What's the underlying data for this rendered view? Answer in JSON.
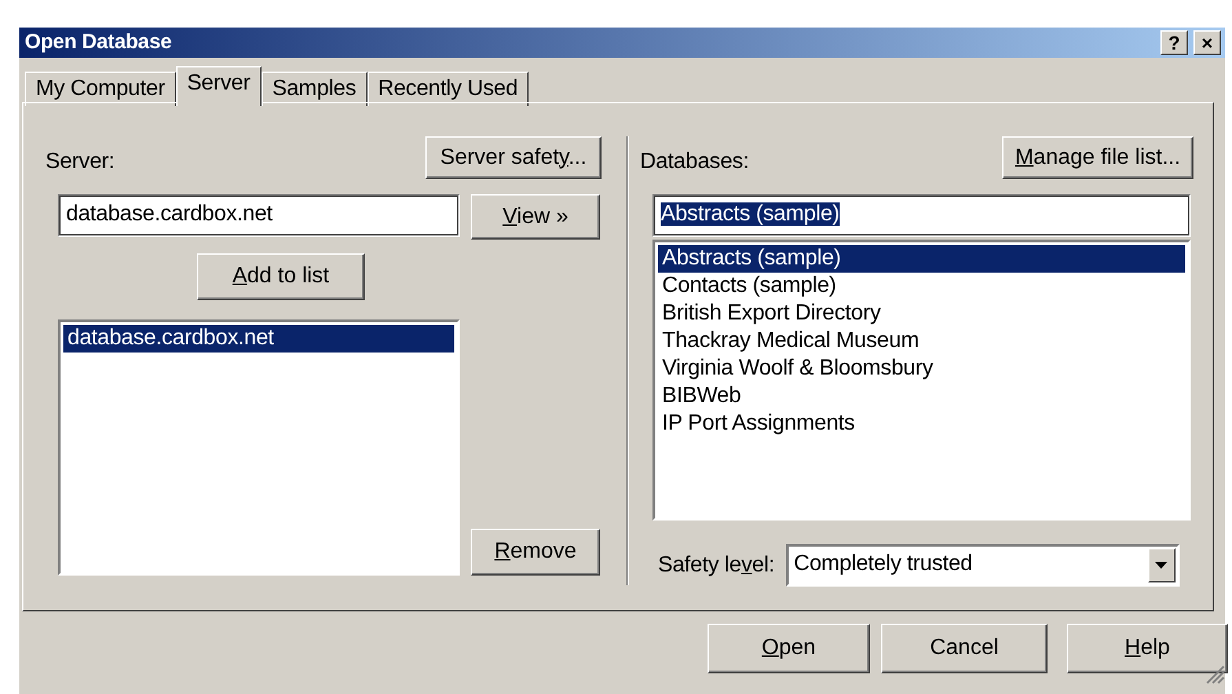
{
  "window": {
    "title": "Open Database",
    "title_buttons": [
      "?",
      "×"
    ]
  },
  "tabs": [
    {
      "label": "My Computer",
      "selected": false
    },
    {
      "label": "Server",
      "selected": true
    },
    {
      "label": "Samples",
      "selected": false
    },
    {
      "label": "Recently Used",
      "selected": false
    }
  ],
  "server_panel": {
    "label": "Server:",
    "safety_button": {
      "label": [
        {
          "text": "Server safet",
          "underlined": false
        },
        {
          "text": "y",
          "underlined": true
        },
        {
          "text": "...",
          "underlined": false
        }
      ]
    },
    "server_field": {
      "value": "database.cardbox.net"
    },
    "view_button": {
      "label": [
        {
          "text": "V",
          "underlined": true
        },
        {
          "text": "iew »",
          "underlined": false
        }
      ]
    },
    "add_button": {
      "label": [
        {
          "text": "A",
          "underlined": true
        },
        {
          "text": "dd to list",
          "underlined": false
        }
      ]
    },
    "servers": [
      {
        "label": "database.cardbox.net",
        "selected": true
      }
    ],
    "remove_button": {
      "label": [
        {
          "text": "R",
          "underlined": true
        },
        {
          "text": "emove",
          "underlined": false
        }
      ]
    }
  },
  "databases_panel": {
    "label": "Databases:",
    "manage_button": {
      "label": [
        {
          "text": "M",
          "underlined": true
        },
        {
          "text": "anage file list...",
          "underlined": false
        }
      ]
    },
    "name_field": {
      "value": "Abstracts (sample)",
      "text_selected": true
    },
    "databases": [
      {
        "label": "Abstracts (sample)",
        "selected": true
      },
      {
        "label": "Contacts (sample)",
        "selected": false
      },
      {
        "label": "British Export Directory",
        "selected": false
      },
      {
        "label": "Thackray Medical Museum",
        "selected": false
      },
      {
        "label": "Virginia Woolf & Bloomsbury",
        "selected": false
      },
      {
        "label": "BIBWeb",
        "selected": false
      },
      {
        "label": "IP Port Assignments",
        "selected": false
      }
    ],
    "safety_level": {
      "label": [
        {
          "text": "Safety le",
          "underlined": false
        },
        {
          "text": "v",
          "underlined": true
        },
        {
          "text": "el:",
          "underlined": false
        }
      ],
      "value": "Completely trusted"
    }
  },
  "buttons": [
    {
      "label": [
        {
          "text": "O",
          "underlined": true
        },
        {
          "text": "pen",
          "underlined": false
        }
      ]
    },
    {
      "label": [
        {
          "text": "Cancel",
          "underlined": false
        }
      ]
    },
    {
      "label": [
        {
          "text": "H",
          "underlined": true
        },
        {
          "text": "elp",
          "underlined": false
        }
      ]
    }
  ]
}
